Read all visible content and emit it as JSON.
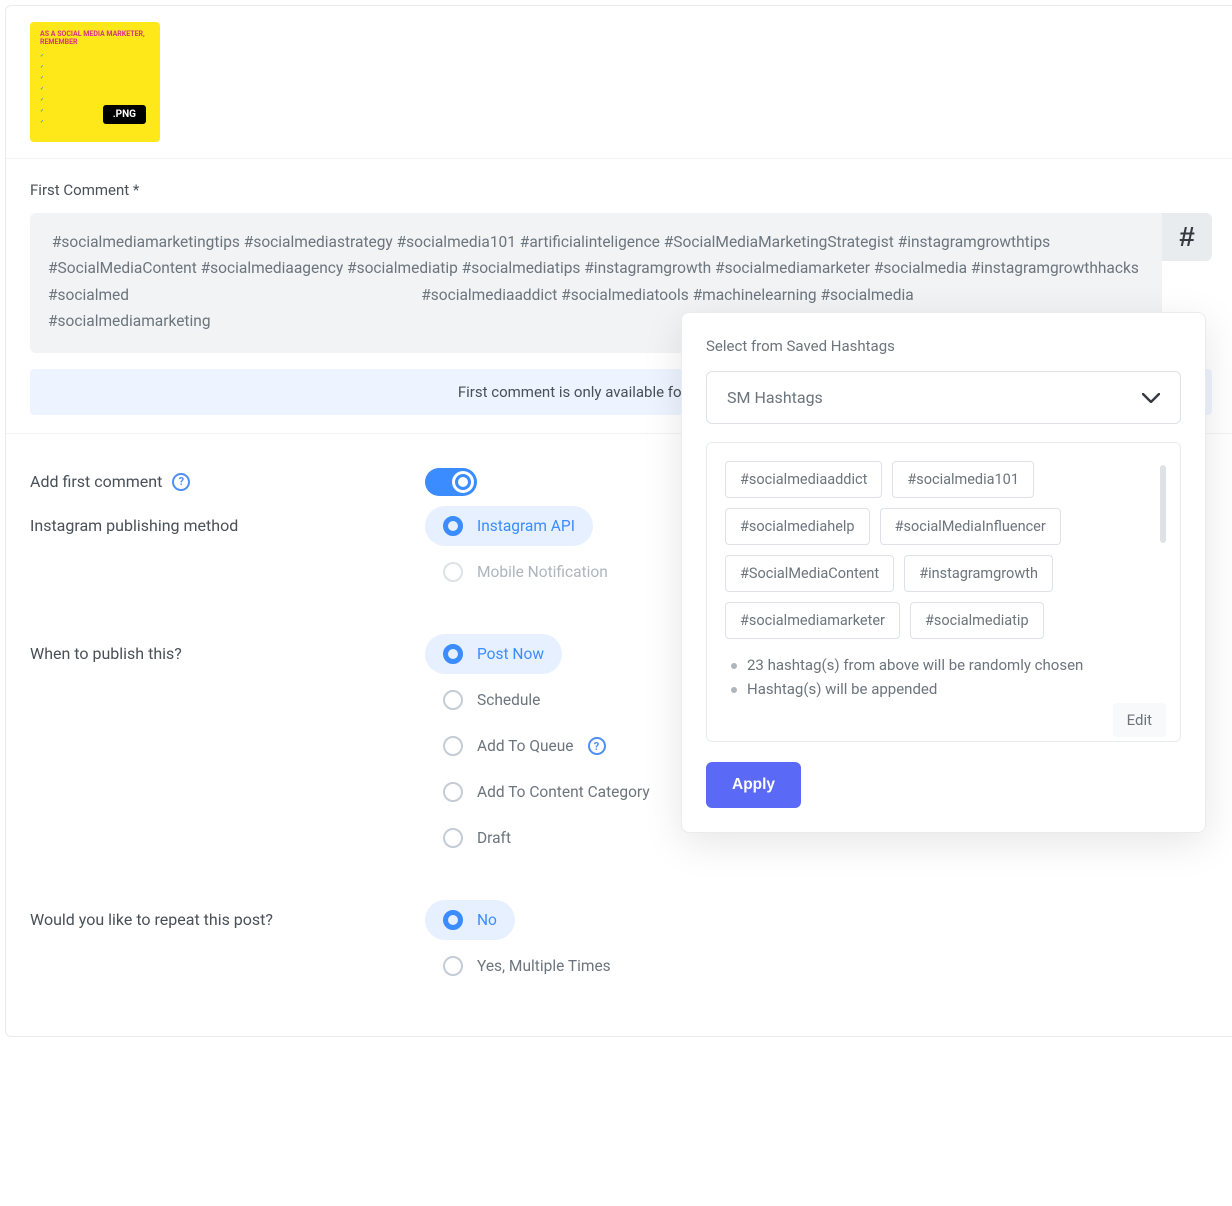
{
  "thumbnail": {
    "title_prefix": "AS A SOCIAL MEDIA MARKETER, ",
    "title_accent": "REMEMBER",
    "badge": ".PNG"
  },
  "firstComment": {
    "label": "First Comment *",
    "text": " #socialmediamarketingtips #socialmediastrategy #socialmedia101 #artificialinteligence #SocialMediaMarketingStrategist #instagramgrowthtips #SocialMediaContent #socialmediaagency #socialmediatip #socialmediatips #instagramgrowth #socialmediamarketer #socialmedia #instagramgrowthhacks #socialmed                                                                            #socialmediaaddict #socialmediatools #machinelearning #socialmedia                                                                            #socialmediamarketing",
    "hash": "#",
    "notice": "First comment is only available for Facebook and"
  },
  "settings": {
    "addFirstComment": {
      "label": "Add first comment",
      "on": true
    },
    "publishMethod": {
      "label": "Instagram publishing method",
      "options": [
        "Instagram API",
        "Mobile Notification"
      ],
      "selected": "Instagram API"
    },
    "whenPublish": {
      "label": "When to publish this?",
      "options": [
        "Post Now",
        "Schedule",
        "Add To Queue",
        "Add To Content Category",
        "Draft"
      ],
      "selected": "Post Now"
    },
    "repeat": {
      "label": "Would you like to repeat this post?",
      "options": [
        "No",
        "Yes, Multiple Times"
      ],
      "selected": "No"
    }
  },
  "popover": {
    "title": "Select from Saved Hashtags",
    "dropdown": "SM Hashtags",
    "tags": [
      "#socialmediaaddict",
      "#socialmedia101",
      "#socialmediahelp",
      "#socialMediaInfluencer",
      "#SocialMediaContent",
      "#instagramgrowth",
      "#socialmediamarketer",
      "#socialmediatip"
    ],
    "bullets": [
      "23 hashtag(s) from above will be randomly chosen",
      "Hashtag(s) will be appended"
    ],
    "edit": "Edit",
    "apply": "Apply"
  }
}
